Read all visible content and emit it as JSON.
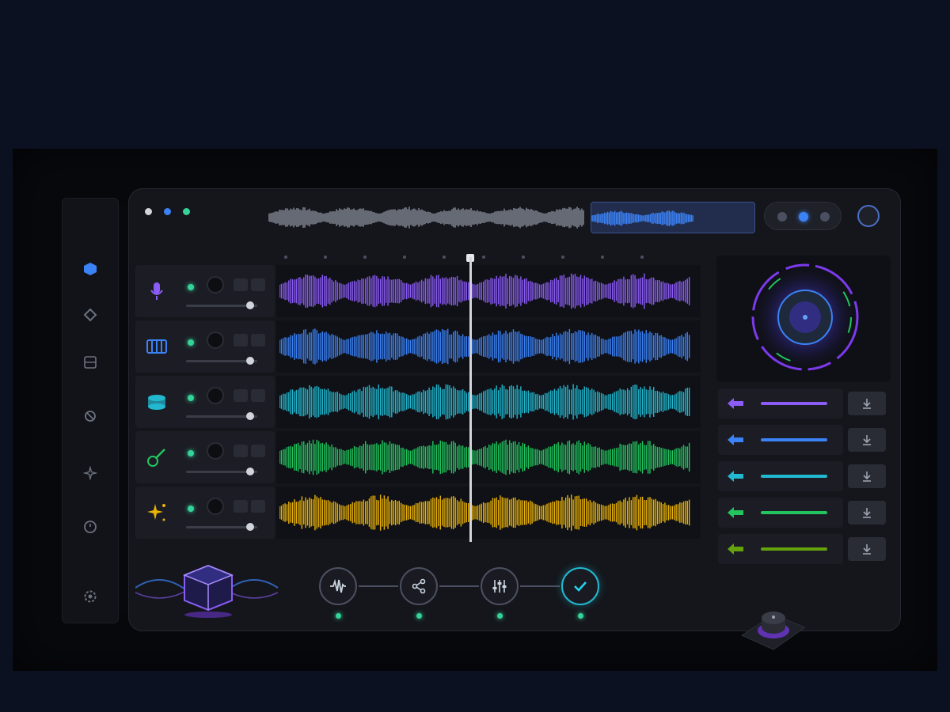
{
  "app": {
    "window_dots": [
      "#d1d5db",
      "#3b82f6",
      "#34d399"
    ]
  },
  "sidebar": {
    "items": [
      {
        "icon": "cube-icon",
        "active": true
      },
      {
        "icon": "diamond-icon",
        "active": false
      },
      {
        "icon": "grid-icon",
        "active": false
      },
      {
        "icon": "refresh-icon",
        "active": false
      },
      {
        "icon": "sparkle-icon",
        "active": false
      },
      {
        "icon": "clock-icon",
        "active": false
      },
      {
        "icon": "gear-icon",
        "active": false
      }
    ]
  },
  "transport": {
    "buttons": [
      "previous-icon",
      "play-dot-icon",
      "next-icon"
    ]
  },
  "tracks": [
    {
      "instrument": "microphone-icon",
      "color": "#8b5cf6",
      "fader": 0.9
    },
    {
      "instrument": "piano-icon",
      "color": "#3b82f6",
      "fader": 0.9
    },
    {
      "instrument": "drum-icon",
      "color": "#22b8cf",
      "fader": 0.9
    },
    {
      "instrument": "guitar-icon",
      "color": "#22c55e",
      "fader": 0.9
    },
    {
      "instrument": "sparkle-icon",
      "color": "#eab308",
      "fader": 0.9
    }
  ],
  "stems": [
    {
      "color": "#8b5cf6"
    },
    {
      "color": "#3b82f6"
    },
    {
      "color": "#22b8cf"
    },
    {
      "color": "#22c55e"
    },
    {
      "color": "#65a30d"
    }
  ],
  "pipeline": {
    "steps": [
      "waveform-icon",
      "share-icon",
      "mixer-icon",
      "check-icon"
    ]
  },
  "colors": {
    "accent_blue": "#3b82f6",
    "accent_purple": "#8b5cf6",
    "accent_green": "#34d399"
  }
}
